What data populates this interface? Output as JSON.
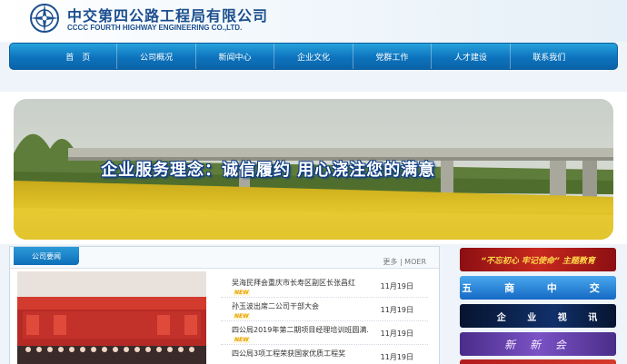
{
  "header": {
    "logo_cn": "中交第四公路工程局有限公司",
    "logo_en": "CCCC FOURTH HIGHWAY ENGINEERING CO.,LTD."
  },
  "nav": {
    "items": [
      "首　页",
      "公司概况",
      "新闻中心",
      "企业文化",
      "党群工作",
      "人才建设",
      "联系我们"
    ]
  },
  "banner": {
    "slogan": "企业服务理念：诚信履约 用心浇注您的满意"
  },
  "news": {
    "tab": "公司要闻",
    "more": "更多 | MOER",
    "new_badge": "NEW",
    "items": [
      {
        "title": "吴海民拜会重庆市长寿区副区长张昌红",
        "date": "11月19日",
        "new": true
      },
      {
        "title": "孙玉波出席二公司干部大会",
        "date": "11月19日",
        "new": true
      },
      {
        "title": "四公局2019年第二期项目经理培训班圆满...",
        "date": "11月19日",
        "new": true
      },
      {
        "title": "四公局3项工程荣获国家优质工程奖",
        "date": "11月19日",
        "new": false
      }
    ]
  },
  "sidebar": {
    "banner1": "“不忘初心 牢记使命” 主题教育",
    "banner2": "五 商 中 交",
    "banner3": "企 业 视 讯",
    "banner4": "新 新 会"
  },
  "colors": {
    "brand_blue": "#1c4f8f",
    "nav_blue": "#0d73bd",
    "accent_red": "#c8281e"
  }
}
